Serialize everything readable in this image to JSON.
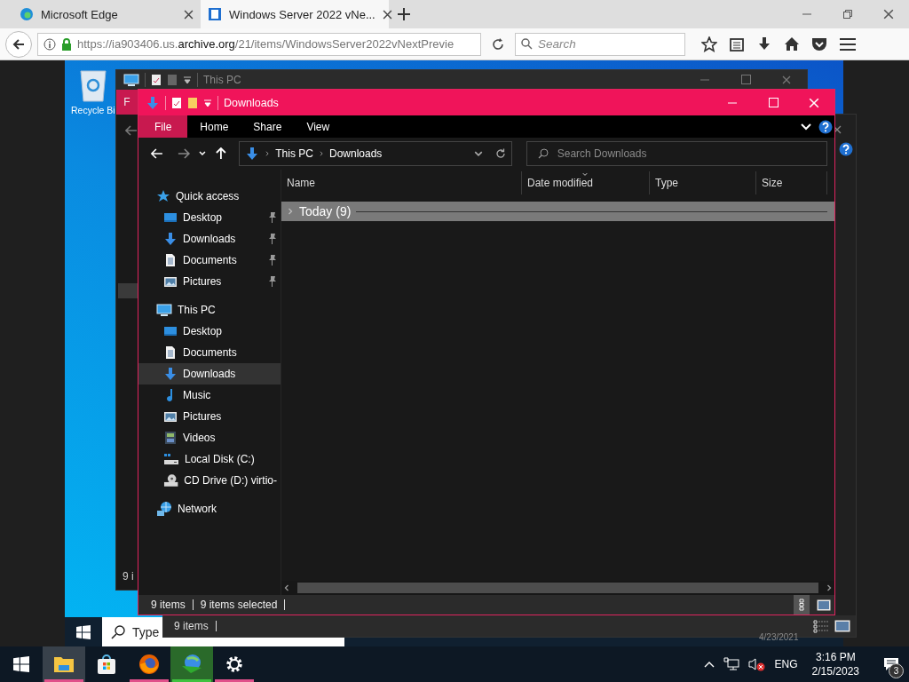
{
  "browser": {
    "tabs": [
      {
        "title": "Microsoft Edge",
        "selected": false
      },
      {
        "title": "Windows Server 2022 vNe...",
        "selected": true
      }
    ],
    "url": {
      "prefix": "https://ia903406.us.",
      "domain": "archive.org",
      "path": "/21/items/WindowsServer2022vNextPrevie"
    },
    "search": {
      "placeholder": "Search"
    }
  },
  "vm": {
    "desktop_icons": [
      {
        "label": "Recycle Bi"
      }
    ],
    "back_window": {
      "title": "This PC",
      "ribbon_tab": "F",
      "status": "9 i"
    },
    "side_window": {
      "status": "9 items",
      "date_peek": "4/23/2021"
    },
    "search": {
      "placeholder": "Type"
    }
  },
  "explorer": {
    "title": "Downloads",
    "ribbon_tabs": [
      {
        "label": "File",
        "selected": true
      },
      {
        "label": "Home",
        "selected": false
      },
      {
        "label": "Share",
        "selected": false
      },
      {
        "label": "View",
        "selected": false
      }
    ],
    "breadcrumb": [
      "This PC",
      "Downloads"
    ],
    "search": {
      "placeholder": "Search Downloads"
    },
    "nav": [
      {
        "label": "Quick access",
        "kind": "star",
        "selected": false,
        "children": [
          {
            "label": "Desktop",
            "kind": "desktop",
            "pinned": true,
            "selected": false
          },
          {
            "label": "Downloads",
            "kind": "download",
            "pinned": true,
            "selected": false
          },
          {
            "label": "Documents",
            "kind": "document",
            "pinned": true,
            "selected": false
          },
          {
            "label": "Pictures",
            "kind": "picture",
            "pinned": true,
            "selected": false
          }
        ]
      },
      {
        "label": "This PC",
        "kind": "pc",
        "selected": false,
        "children": [
          {
            "label": "Desktop",
            "kind": "desktop",
            "pinned": false,
            "selected": false
          },
          {
            "label": "Documents",
            "kind": "document",
            "pinned": false,
            "selected": false
          },
          {
            "label": "Downloads",
            "kind": "download",
            "pinned": false,
            "selected": true
          },
          {
            "label": "Music",
            "kind": "music",
            "pinned": false,
            "selected": false
          },
          {
            "label": "Pictures",
            "kind": "picture",
            "pinned": false,
            "selected": false
          },
          {
            "label": "Videos",
            "kind": "video",
            "pinned": false,
            "selected": false
          },
          {
            "label": "Local Disk (C:)",
            "kind": "disk",
            "pinned": false,
            "selected": false
          },
          {
            "label": "CD Drive (D:) virtio-",
            "kind": "cd",
            "pinned": false,
            "selected": false
          }
        ]
      },
      {
        "label": "Network",
        "kind": "network",
        "selected": false
      }
    ],
    "columns": [
      {
        "label": "Name",
        "sorted": false
      },
      {
        "label": "Date modified",
        "sorted": true
      },
      {
        "label": "Type",
        "sorted": false
      },
      {
        "label": "Size",
        "sorted": false
      }
    ],
    "groups": [
      {
        "label": "Today (9)",
        "expanded": false
      }
    ],
    "status": {
      "count": "9 items",
      "selection": "9 items selected"
    }
  },
  "taskbar": {
    "apps": [
      {
        "kind": "explorer",
        "selected": true,
        "running": true
      },
      {
        "kind": "store",
        "selected": false,
        "running": false
      },
      {
        "kind": "firefox",
        "selected": false,
        "running": true
      },
      {
        "kind": "download-manager",
        "selected": false,
        "running": true
      },
      {
        "kind": "settings",
        "selected": false,
        "running": true
      }
    ],
    "tray": {
      "language": "ENG",
      "time": "3:16 PM",
      "date": "2/15/2023",
      "notifications": "3"
    }
  }
}
